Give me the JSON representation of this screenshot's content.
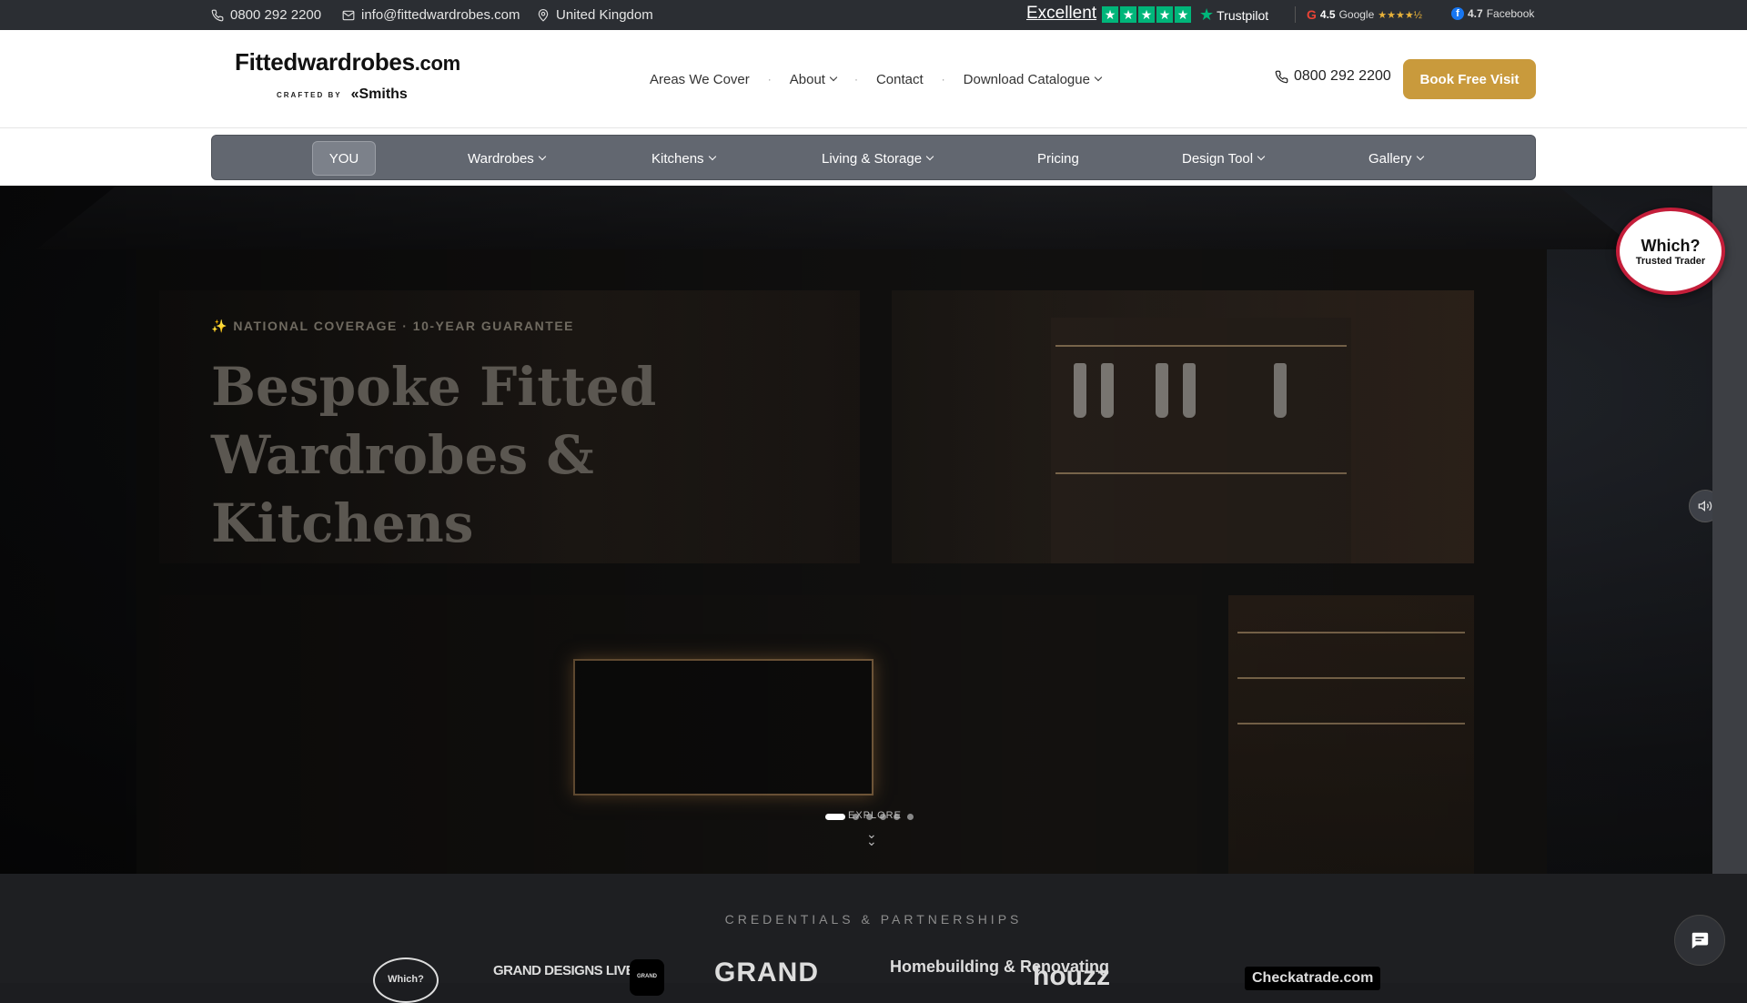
{
  "topbar": {
    "phone": "0800 292 2200",
    "email": "info@fittedwardrobes.com",
    "location": "United Kingdom",
    "trustpilot_label": "Excellent",
    "trustpilot_brand": "Trustpilot",
    "google_rating": "4.5",
    "google_label": "Google",
    "google_stars": "★★★★½",
    "facebook_rating": "4.7",
    "facebook_label": "Facebook"
  },
  "header": {
    "logo_main": "Fittedwardrobes",
    "logo_suffix": ".com",
    "logo_crafted": "CRAFTED BY",
    "logo_brand": "Smiths",
    "nav": [
      {
        "label": "Areas We Cover"
      },
      {
        "label": "About"
      },
      {
        "label": "Contact"
      },
      {
        "label": "Download Catalogue"
      }
    ],
    "phone": "0800 292 2200",
    "cta": "Book Free Visit"
  },
  "subnav": {
    "items": [
      {
        "label": "YOU"
      },
      {
        "label": "Wardrobes"
      },
      {
        "label": "Kitchens"
      },
      {
        "label": "Living & Storage"
      },
      {
        "label": "Pricing"
      },
      {
        "label": "Design Tool"
      },
      {
        "label": "Gallery"
      }
    ]
  },
  "hero": {
    "eyebrow": "✨ NATIONAL COVERAGE · 10-YEAR GUARANTEE",
    "title": "Bespoke Fitted Wardrobes & Kitchens",
    "explore": "EXPLORE",
    "slide_count": 6,
    "active_slide": 1
  },
  "badge": {
    "line1": "Which?",
    "line2": "Trusted Trader"
  },
  "credentials": {
    "title": "CREDENTIALS & PARTNERSHIPS",
    "logos": [
      "Which?",
      "GRAND DESIGNS LIVE",
      "GRAND",
      "GRAND",
      "Homebuilding & Renovating",
      "houzz",
      "Checkatrade.com"
    ]
  },
  "colors": {
    "accent": "#c99a3c",
    "topbar": "#2b2e33",
    "subnav": "#626770",
    "trustpilot": "#00b67a",
    "which_red": "#c41e3a"
  }
}
